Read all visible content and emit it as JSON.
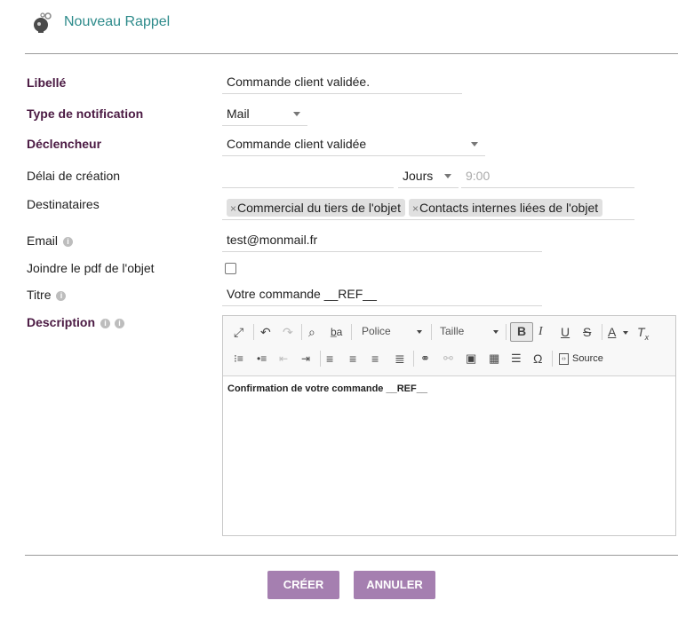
{
  "header": {
    "title": "Nouveau Rappel",
    "logo_icon": "bell-gear-icon"
  },
  "form": {
    "libelle": {
      "label": "Libellé",
      "value": "Commande client validée."
    },
    "type_notification": {
      "label": "Type de notification",
      "value": "Mail"
    },
    "declencheur": {
      "label": "Déclencheur",
      "value": "Commande client validée"
    },
    "delai": {
      "label": "Délai de création",
      "value": "",
      "unit": "Jours",
      "time_placeholder": "9:00"
    },
    "destinataires": {
      "label": "Destinataires",
      "tags": [
        "Commercial du tiers de l'objet",
        "Contacts internes liées de l'objet"
      ]
    },
    "email": {
      "label": "Email",
      "value": "test@monmail.fr"
    },
    "joindre_pdf": {
      "label": "Joindre le pdf de l'objet",
      "checked": false
    },
    "titre": {
      "label": "Titre",
      "value": "Votre commande  __REF__"
    },
    "description": {
      "label": "Description",
      "toolbar": {
        "font_label": "Police",
        "size_label": "Taille",
        "source_label": "Source"
      },
      "content": "Confirmation de votre commande  __REF__"
    }
  },
  "actions": {
    "create_label": "CRÉER",
    "cancel_label": "ANNULER"
  },
  "colors": {
    "label_bold": "#4a1942",
    "title": "#2e8b8b",
    "button": "#a57fb0"
  }
}
